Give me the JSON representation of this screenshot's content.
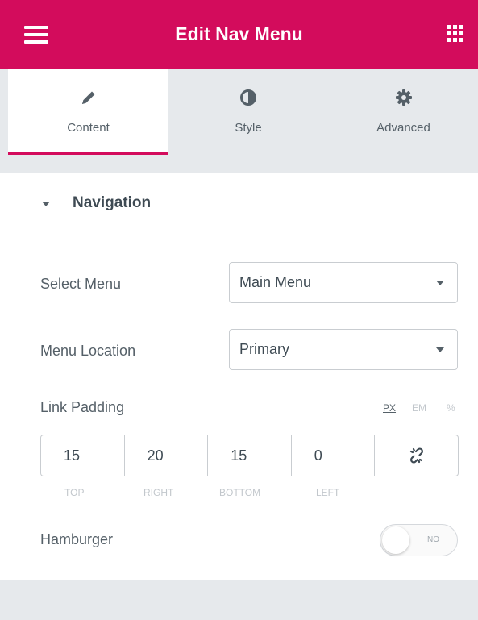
{
  "colors": {
    "accent": "#d30c5c"
  },
  "header": {
    "title": "Edit Nav Menu",
    "menu_icon": "hamburger-icon",
    "apps_icon": "grid-icon"
  },
  "tabs": [
    {
      "label": "Content",
      "icon": "pencil-icon",
      "active": true
    },
    {
      "label": "Style",
      "icon": "half-circle-icon",
      "active": false
    },
    {
      "label": "Advanced",
      "icon": "gear-icon",
      "active": false
    }
  ],
  "section": {
    "title": "Navigation",
    "expanded": true
  },
  "fields": {
    "select_menu": {
      "label": "Select Menu",
      "value": "Main Menu"
    },
    "menu_location": {
      "label": "Menu Location",
      "value": "Primary"
    },
    "link_padding": {
      "label": "Link Padding",
      "units": [
        "PX",
        "EM",
        "%"
      ],
      "active_unit": "PX",
      "values": [
        {
          "label": "TOP",
          "value": "15"
        },
        {
          "label": "RIGHT",
          "value": "20"
        },
        {
          "label": "BOTTOM",
          "value": "15"
        },
        {
          "label": "LEFT",
          "value": "0"
        }
      ],
      "link_icon": "unlink-icon"
    },
    "hamburger": {
      "label": "Hamburger",
      "state": "NO"
    }
  }
}
